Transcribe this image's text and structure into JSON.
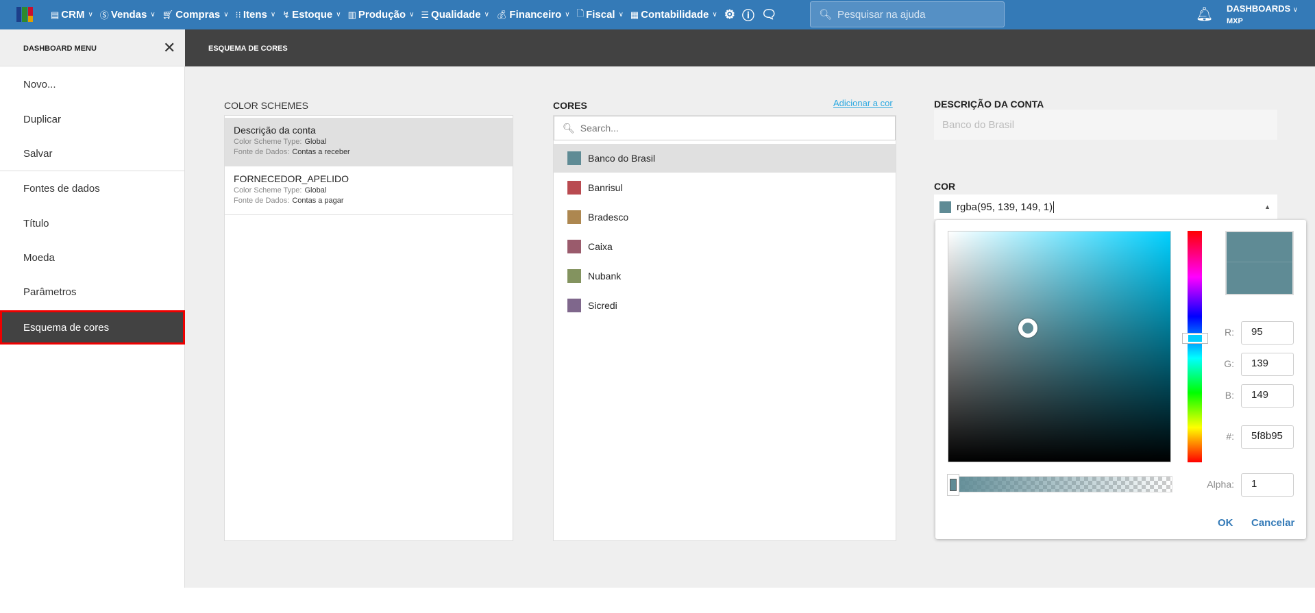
{
  "topnav": {
    "menu": [
      {
        "label": "CRM",
        "icon": "crm-icon"
      },
      {
        "label": "Vendas",
        "icon": "dollar-icon"
      },
      {
        "label": "Compras",
        "icon": "cart-icon"
      },
      {
        "label": "Itens",
        "icon": "items-icon"
      },
      {
        "label": "Estoque",
        "icon": "stock-icon"
      },
      {
        "label": "Produção",
        "icon": "factory-icon"
      },
      {
        "label": "Qualidade",
        "icon": "checklist-icon"
      },
      {
        "label": "Financeiro",
        "icon": "moneybag-icon"
      },
      {
        "label": "Fiscal",
        "icon": "document-icon"
      },
      {
        "label": "Contabilidade",
        "icon": "calculator-icon"
      }
    ],
    "search_placeholder": "Pesquisar na ajuda",
    "user_title": "DASHBOARDS",
    "user_sub": "MXP"
  },
  "sidebar": {
    "title": "DASHBOARD MENU",
    "items": [
      {
        "label": "Novo..."
      },
      {
        "label": "Duplicar"
      },
      {
        "label": "Salvar"
      },
      {
        "label": "Fontes de dados"
      },
      {
        "label": "Título"
      },
      {
        "label": "Moeda"
      },
      {
        "label": "Parâmetros"
      },
      {
        "label": "Esquema de cores"
      }
    ]
  },
  "page": {
    "title": "ESQUEMA DE CORES"
  },
  "schemes": {
    "label": "COLOR SCHEMES",
    "type_label": "Color Scheme Type:",
    "source_label": "Fonte de Dados:",
    "items": [
      {
        "name": "Descrição da conta",
        "type": "Global",
        "source": "Contas a receber"
      },
      {
        "name": "FORNECEDOR_APELIDO",
        "type": "Global",
        "source": "Contas a pagar"
      }
    ]
  },
  "colors": {
    "label": "CORES",
    "add_link": "Adicionar a cor",
    "search_placeholder": "Search...",
    "items": [
      {
        "name": "Banco do Brasil",
        "color": "#5f8b95"
      },
      {
        "name": "Banrisul",
        "color": "#b94a50"
      },
      {
        "name": "Bradesco",
        "color": "#ad8750"
      },
      {
        "name": "Caixa",
        "color": "#9a5b6c"
      },
      {
        "name": "Nubank",
        "color": "#83935f"
      },
      {
        "name": "Sicredi",
        "color": "#7f678c"
      }
    ]
  },
  "detail": {
    "desc_label": "DESCRIÇÃO DA CONTA",
    "desc_value": "Banco do Brasil",
    "color_label": "COR",
    "color_value": "rgba(95, 139, 149, 1)",
    "color_hex": "#5f8b95"
  },
  "picker": {
    "r_label": "R:",
    "r": "95",
    "g_label": "G:",
    "g": "139",
    "b_label": "B:",
    "b": "149",
    "hex_label": "#:",
    "hex": "5f8b95",
    "alpha_label": "Alpha:",
    "alpha": "1",
    "ok": "OK",
    "cancel": "Cancelar"
  }
}
